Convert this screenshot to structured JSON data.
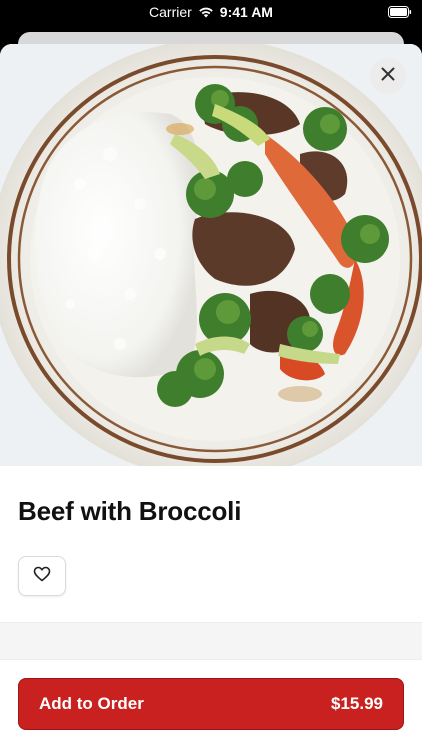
{
  "status_bar": {
    "carrier": "Carrier",
    "time": "9:41 AM",
    "icons": [
      "wifi-icon",
      "battery-icon"
    ]
  },
  "item": {
    "title": "Beef with Broccoli",
    "image_icon": "beef-broccoli-plate-image"
  },
  "actions": {
    "close_icon": "close-icon",
    "favorite_icon": "heart-icon",
    "add_label": "Add to Order",
    "price": "$15.99"
  },
  "colors": {
    "accent": "#c8211f",
    "background": "#ffffff",
    "text": "#111111"
  }
}
